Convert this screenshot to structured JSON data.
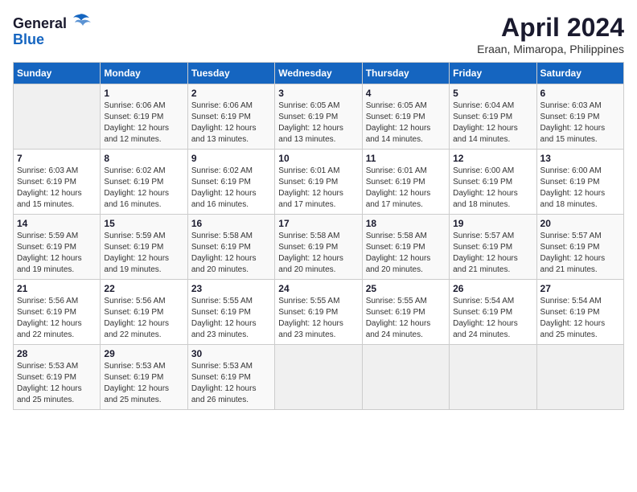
{
  "header": {
    "logo_general": "General",
    "logo_blue": "Blue",
    "month_title": "April 2024",
    "subtitle": "Eraan, Mimaropa, Philippines"
  },
  "calendar": {
    "days_of_week": [
      "Sunday",
      "Monday",
      "Tuesday",
      "Wednesday",
      "Thursday",
      "Friday",
      "Saturday"
    ],
    "weeks": [
      [
        {
          "day": "",
          "info": ""
        },
        {
          "day": "1",
          "info": "Sunrise: 6:06 AM\nSunset: 6:19 PM\nDaylight: 12 hours\nand 12 minutes."
        },
        {
          "day": "2",
          "info": "Sunrise: 6:06 AM\nSunset: 6:19 PM\nDaylight: 12 hours\nand 13 minutes."
        },
        {
          "day": "3",
          "info": "Sunrise: 6:05 AM\nSunset: 6:19 PM\nDaylight: 12 hours\nand 13 minutes."
        },
        {
          "day": "4",
          "info": "Sunrise: 6:05 AM\nSunset: 6:19 PM\nDaylight: 12 hours\nand 14 minutes."
        },
        {
          "day": "5",
          "info": "Sunrise: 6:04 AM\nSunset: 6:19 PM\nDaylight: 12 hours\nand 14 minutes."
        },
        {
          "day": "6",
          "info": "Sunrise: 6:03 AM\nSunset: 6:19 PM\nDaylight: 12 hours\nand 15 minutes."
        }
      ],
      [
        {
          "day": "7",
          "info": "Sunrise: 6:03 AM\nSunset: 6:19 PM\nDaylight: 12 hours\nand 15 minutes."
        },
        {
          "day": "8",
          "info": "Sunrise: 6:02 AM\nSunset: 6:19 PM\nDaylight: 12 hours\nand 16 minutes."
        },
        {
          "day": "9",
          "info": "Sunrise: 6:02 AM\nSunset: 6:19 PM\nDaylight: 12 hours\nand 16 minutes."
        },
        {
          "day": "10",
          "info": "Sunrise: 6:01 AM\nSunset: 6:19 PM\nDaylight: 12 hours\nand 17 minutes."
        },
        {
          "day": "11",
          "info": "Sunrise: 6:01 AM\nSunset: 6:19 PM\nDaylight: 12 hours\nand 17 minutes."
        },
        {
          "day": "12",
          "info": "Sunrise: 6:00 AM\nSunset: 6:19 PM\nDaylight: 12 hours\nand 18 minutes."
        },
        {
          "day": "13",
          "info": "Sunrise: 6:00 AM\nSunset: 6:19 PM\nDaylight: 12 hours\nand 18 minutes."
        }
      ],
      [
        {
          "day": "14",
          "info": "Sunrise: 5:59 AM\nSunset: 6:19 PM\nDaylight: 12 hours\nand 19 minutes."
        },
        {
          "day": "15",
          "info": "Sunrise: 5:59 AM\nSunset: 6:19 PM\nDaylight: 12 hours\nand 19 minutes."
        },
        {
          "day": "16",
          "info": "Sunrise: 5:58 AM\nSunset: 6:19 PM\nDaylight: 12 hours\nand 20 minutes."
        },
        {
          "day": "17",
          "info": "Sunrise: 5:58 AM\nSunset: 6:19 PM\nDaylight: 12 hours\nand 20 minutes."
        },
        {
          "day": "18",
          "info": "Sunrise: 5:58 AM\nSunset: 6:19 PM\nDaylight: 12 hours\nand 20 minutes."
        },
        {
          "day": "19",
          "info": "Sunrise: 5:57 AM\nSunset: 6:19 PM\nDaylight: 12 hours\nand 21 minutes."
        },
        {
          "day": "20",
          "info": "Sunrise: 5:57 AM\nSunset: 6:19 PM\nDaylight: 12 hours\nand 21 minutes."
        }
      ],
      [
        {
          "day": "21",
          "info": "Sunrise: 5:56 AM\nSunset: 6:19 PM\nDaylight: 12 hours\nand 22 minutes."
        },
        {
          "day": "22",
          "info": "Sunrise: 5:56 AM\nSunset: 6:19 PM\nDaylight: 12 hours\nand 22 minutes."
        },
        {
          "day": "23",
          "info": "Sunrise: 5:55 AM\nSunset: 6:19 PM\nDaylight: 12 hours\nand 23 minutes."
        },
        {
          "day": "24",
          "info": "Sunrise: 5:55 AM\nSunset: 6:19 PM\nDaylight: 12 hours\nand 23 minutes."
        },
        {
          "day": "25",
          "info": "Sunrise: 5:55 AM\nSunset: 6:19 PM\nDaylight: 12 hours\nand 24 minutes."
        },
        {
          "day": "26",
          "info": "Sunrise: 5:54 AM\nSunset: 6:19 PM\nDaylight: 12 hours\nand 24 minutes."
        },
        {
          "day": "27",
          "info": "Sunrise: 5:54 AM\nSunset: 6:19 PM\nDaylight: 12 hours\nand 25 minutes."
        }
      ],
      [
        {
          "day": "28",
          "info": "Sunrise: 5:53 AM\nSunset: 6:19 PM\nDaylight: 12 hours\nand 25 minutes."
        },
        {
          "day": "29",
          "info": "Sunrise: 5:53 AM\nSunset: 6:19 PM\nDaylight: 12 hours\nand 25 minutes."
        },
        {
          "day": "30",
          "info": "Sunrise: 5:53 AM\nSunset: 6:19 PM\nDaylight: 12 hours\nand 26 minutes."
        },
        {
          "day": "",
          "info": ""
        },
        {
          "day": "",
          "info": ""
        },
        {
          "day": "",
          "info": ""
        },
        {
          "day": "",
          "info": ""
        }
      ]
    ]
  }
}
